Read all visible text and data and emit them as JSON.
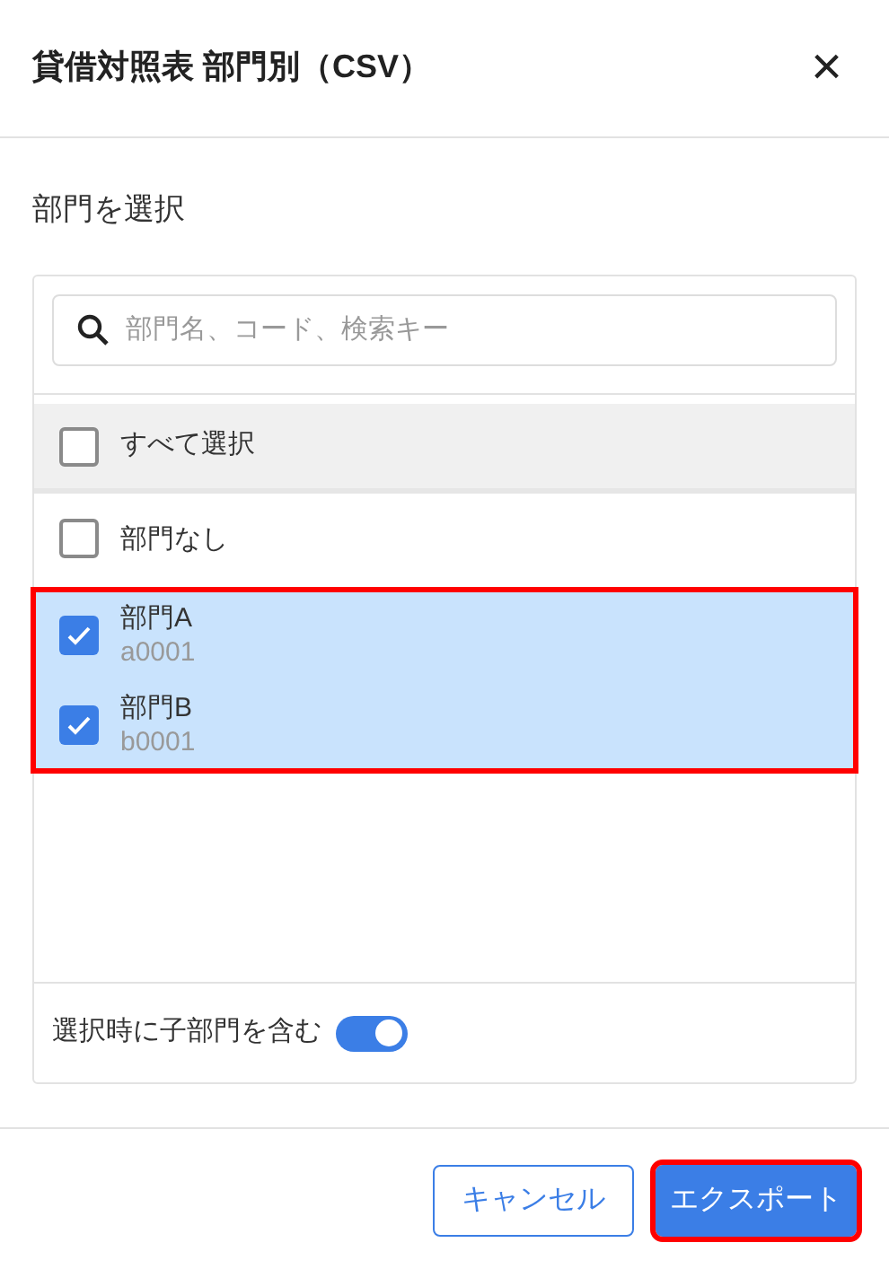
{
  "dialog": {
    "title": "貸借対照表 部門別（CSV）",
    "close": "×"
  },
  "section_label": "部門を選択",
  "search": {
    "placeholder": "部門名、コード、検索キー"
  },
  "select_all": {
    "label": "すべて選択",
    "checked": false
  },
  "departments": [
    {
      "name": "部門なし",
      "checked": false
    },
    {
      "name": "部門A",
      "code": "a0001",
      "checked": true
    },
    {
      "name": "部門B",
      "code": "b0001",
      "checked": true
    }
  ],
  "highlight_checked_rows": true,
  "include_children": {
    "label": "選択時に子部門を含む",
    "on": true
  },
  "buttons": [
    {
      "label": "キャンセル",
      "kind": "secondary",
      "highlighted": false
    },
    {
      "label": "エクスポート",
      "kind": "primary",
      "highlighted": true
    }
  ]
}
